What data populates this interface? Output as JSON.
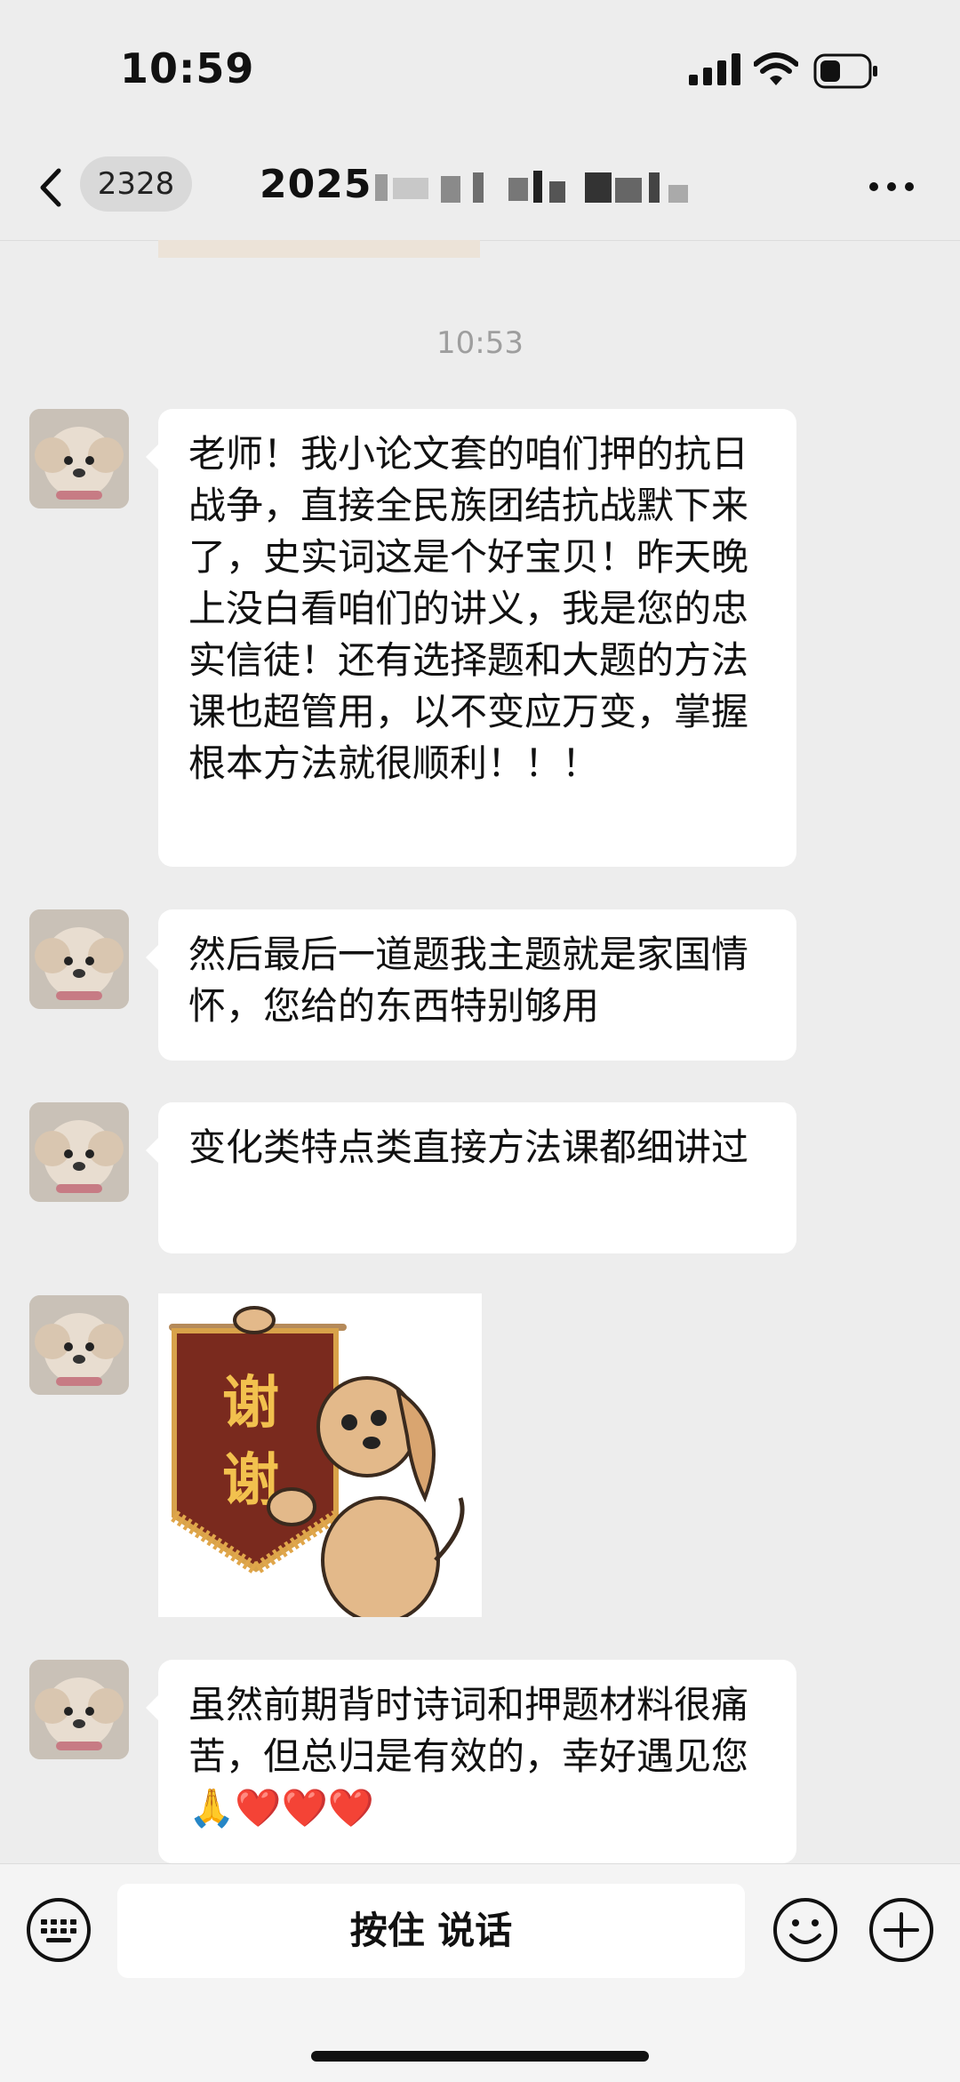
{
  "status_bar": {
    "time": "10:59"
  },
  "nav": {
    "unread_count": "2328",
    "title": "2025"
  },
  "chat": {
    "time_divider": "10:53",
    "messages": [
      {
        "type": "text",
        "text": "老师！我小论文套的咱们押的抗日战争，直接全民族团结抗战默下来了，史实词这是个好宝贝！昨天晚上没白看咱们的讲义，我是您的忠实信徒！还有选择题和大题的方法课也超管用，以不变应万变，掌握根本方法就很顺利！！！"
      },
      {
        "type": "text",
        "text": "然后最后一道题我主题就是家国情怀，您给的东西特别够用"
      },
      {
        "type": "text",
        "text": "变化类特点类直接方法课都细讲过"
      },
      {
        "type": "sticker",
        "banner_text": "谢谢",
        "banner_chars": [
          "谢",
          "谢"
        ]
      },
      {
        "type": "text",
        "text": "虽然前期背时诗词和押题材料很痛苦，但总归是有效的，幸好遇见您🙏❤️❤️❤️"
      }
    ]
  },
  "input_bar": {
    "hold_to_talk_label": "按住 说话"
  }
}
